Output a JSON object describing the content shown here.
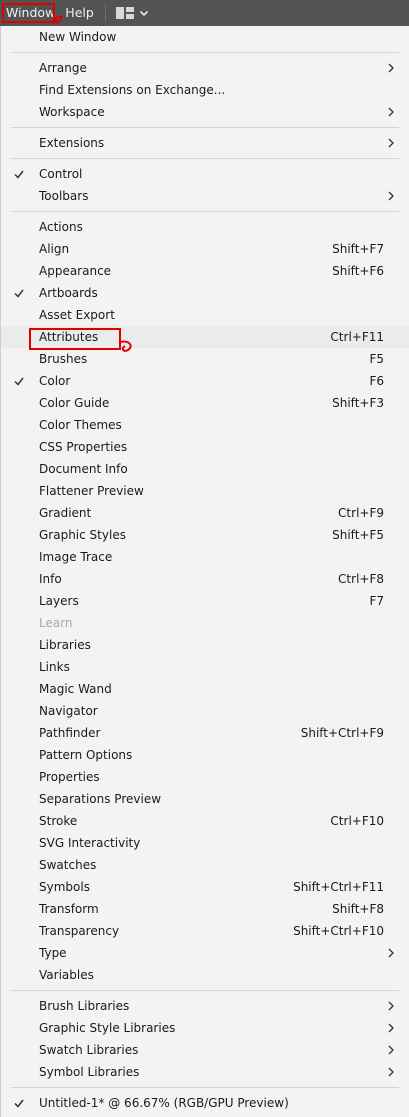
{
  "menubar": {
    "window_label": "Window",
    "help_label": "Help",
    "layout_icon": "workspace-layout-icon",
    "chevron_icon": "chevron-down-icon"
  },
  "colors": {
    "menubar_bg": "#535353",
    "menu_bg": "#f3f3f3",
    "annotation": "#e00000"
  },
  "menu": {
    "items": [
      {
        "label": "New Window",
        "shortcut": "",
        "submenu": false,
        "checked": false,
        "disabled": false
      },
      {
        "label": "Arrange",
        "shortcut": "",
        "submenu": true,
        "checked": false,
        "disabled": false
      },
      {
        "label": "Find Extensions on Exchange...",
        "shortcut": "",
        "submenu": false,
        "checked": false,
        "disabled": false
      },
      {
        "label": "Workspace",
        "shortcut": "",
        "submenu": true,
        "checked": false,
        "disabled": false
      },
      {
        "label": "Extensions",
        "shortcut": "",
        "submenu": true,
        "checked": false,
        "disabled": false
      },
      {
        "label": "Control",
        "shortcut": "",
        "submenu": false,
        "checked": true,
        "disabled": false
      },
      {
        "label": "Toolbars",
        "shortcut": "",
        "submenu": true,
        "checked": false,
        "disabled": false
      },
      {
        "label": "Actions",
        "shortcut": "",
        "submenu": false,
        "checked": false,
        "disabled": false
      },
      {
        "label": "Align",
        "shortcut": "Shift+F7",
        "submenu": false,
        "checked": false,
        "disabled": false
      },
      {
        "label": "Appearance",
        "shortcut": "Shift+F6",
        "submenu": false,
        "checked": false,
        "disabled": false
      },
      {
        "label": "Artboards",
        "shortcut": "",
        "submenu": false,
        "checked": true,
        "disabled": false
      },
      {
        "label": "Asset Export",
        "shortcut": "",
        "submenu": false,
        "checked": false,
        "disabled": false
      },
      {
        "label": "Attributes",
        "shortcut": "Ctrl+F11",
        "submenu": false,
        "checked": false,
        "disabled": false,
        "hover": true
      },
      {
        "label": "Brushes",
        "shortcut": "F5",
        "submenu": false,
        "checked": false,
        "disabled": false
      },
      {
        "label": "Color",
        "shortcut": "F6",
        "submenu": false,
        "checked": true,
        "disabled": false
      },
      {
        "label": "Color Guide",
        "shortcut": "Shift+F3",
        "submenu": false,
        "checked": false,
        "disabled": false
      },
      {
        "label": "Color Themes",
        "shortcut": "",
        "submenu": false,
        "checked": false,
        "disabled": false
      },
      {
        "label": "CSS Properties",
        "shortcut": "",
        "submenu": false,
        "checked": false,
        "disabled": false
      },
      {
        "label": "Document Info",
        "shortcut": "",
        "submenu": false,
        "checked": false,
        "disabled": false
      },
      {
        "label": "Flattener Preview",
        "shortcut": "",
        "submenu": false,
        "checked": false,
        "disabled": false
      },
      {
        "label": "Gradient",
        "shortcut": "Ctrl+F9",
        "submenu": false,
        "checked": false,
        "disabled": false
      },
      {
        "label": "Graphic Styles",
        "shortcut": "Shift+F5",
        "submenu": false,
        "checked": false,
        "disabled": false
      },
      {
        "label": "Image Trace",
        "shortcut": "",
        "submenu": false,
        "checked": false,
        "disabled": false
      },
      {
        "label": "Info",
        "shortcut": "Ctrl+F8",
        "submenu": false,
        "checked": false,
        "disabled": false
      },
      {
        "label": "Layers",
        "shortcut": "F7",
        "submenu": false,
        "checked": false,
        "disabled": false
      },
      {
        "label": "Learn",
        "shortcut": "",
        "submenu": false,
        "checked": false,
        "disabled": true
      },
      {
        "label": "Libraries",
        "shortcut": "",
        "submenu": false,
        "checked": false,
        "disabled": false
      },
      {
        "label": "Links",
        "shortcut": "",
        "submenu": false,
        "checked": false,
        "disabled": false
      },
      {
        "label": "Magic Wand",
        "shortcut": "",
        "submenu": false,
        "checked": false,
        "disabled": false
      },
      {
        "label": "Navigator",
        "shortcut": "",
        "submenu": false,
        "checked": false,
        "disabled": false
      },
      {
        "label": "Pathfinder",
        "shortcut": "Shift+Ctrl+F9",
        "submenu": false,
        "checked": false,
        "disabled": false
      },
      {
        "label": "Pattern Options",
        "shortcut": "",
        "submenu": false,
        "checked": false,
        "disabled": false
      },
      {
        "label": "Properties",
        "shortcut": "",
        "submenu": false,
        "checked": false,
        "disabled": false
      },
      {
        "label": "Separations Preview",
        "shortcut": "",
        "submenu": false,
        "checked": false,
        "disabled": false
      },
      {
        "label": "Stroke",
        "shortcut": "Ctrl+F10",
        "submenu": false,
        "checked": false,
        "disabled": false
      },
      {
        "label": "SVG Interactivity",
        "shortcut": "",
        "submenu": false,
        "checked": false,
        "disabled": false
      },
      {
        "label": "Swatches",
        "shortcut": "",
        "submenu": false,
        "checked": false,
        "disabled": false
      },
      {
        "label": "Symbols",
        "shortcut": "Shift+Ctrl+F11",
        "submenu": false,
        "checked": false,
        "disabled": false
      },
      {
        "label": "Transform",
        "shortcut": "Shift+F8",
        "submenu": false,
        "checked": false,
        "disabled": false
      },
      {
        "label": "Transparency",
        "shortcut": "Shift+Ctrl+F10",
        "submenu": false,
        "checked": false,
        "disabled": false
      },
      {
        "label": "Type",
        "shortcut": "",
        "submenu": true,
        "checked": false,
        "disabled": false
      },
      {
        "label": "Variables",
        "shortcut": "",
        "submenu": false,
        "checked": false,
        "disabled": false
      },
      {
        "label": "Brush Libraries",
        "shortcut": "",
        "submenu": true,
        "checked": false,
        "disabled": false
      },
      {
        "label": "Graphic Style Libraries",
        "shortcut": "",
        "submenu": true,
        "checked": false,
        "disabled": false
      },
      {
        "label": "Swatch Libraries",
        "shortcut": "",
        "submenu": true,
        "checked": false,
        "disabled": false
      },
      {
        "label": "Symbol Libraries",
        "shortcut": "",
        "submenu": true,
        "checked": false,
        "disabled": false
      },
      {
        "label": "Untitled-1* @ 66.67% (RGB/GPU Preview)",
        "shortcut": "",
        "submenu": false,
        "checked": true,
        "disabled": false
      }
    ]
  }
}
